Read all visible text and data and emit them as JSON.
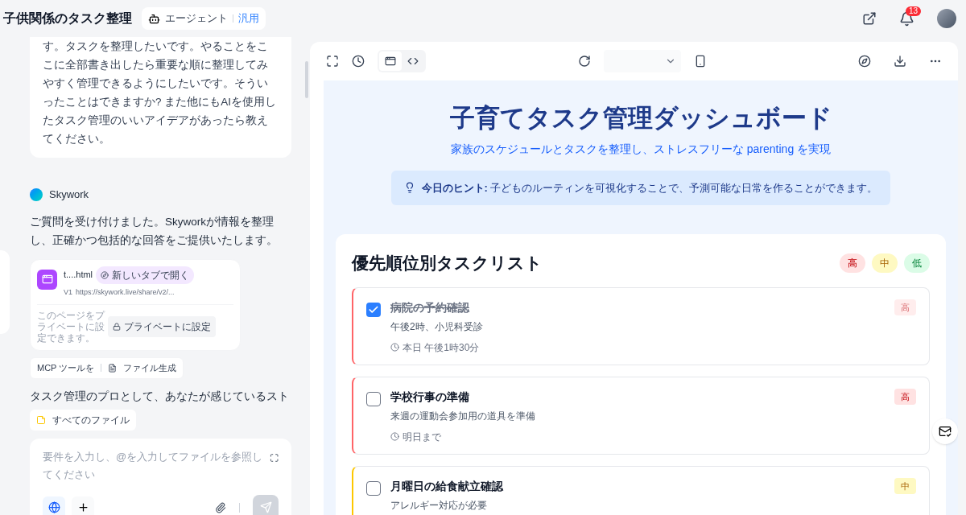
{
  "header": {
    "title": "子供関係のタスク整理",
    "mode": "エージェント",
    "mode_type": "汎用",
    "notification_count": "13"
  },
  "chat": {
    "user_message": "す。タスクを整理したいです。やることをここに全部書き出したら重要な順に整理してみやすく管理できるようにしたいです。そういったことはできますか? また他にもAIを使用したタスク管理のいいアイデアがあったら教えてください。",
    "assistant_name": "Skywork",
    "assistant_message": "ご質問を受け付けました。Skyworkが情報を整理し、正確かつ包括的な回答をご提供いたします。",
    "file_card": {
      "name": "t....html",
      "open_button": "新しいタブで開く",
      "version": "V1",
      "url": "https://skywork.live/share/v2/...",
      "privacy_note": "このページをプライベートに設定できます。",
      "private_button": "プライベートに設定"
    },
    "tools": [
      "MCP ツールを",
      "ファイル生成"
    ],
    "streaming_text": "タスク管理のプロとして、あなたが感じているスト",
    "all_files": "すべてのファイル",
    "input": {
      "placeholder": "要件を入力し、@を入力してファイルを参照してください",
      "web_search_on": true
    }
  },
  "preview": {
    "view_tabs": [
      {
        "kind": "preview",
        "selected": true
      },
      {
        "kind": "code",
        "selected": false
      }
    ],
    "page": {
      "title": "子育てタスク管理ダッシュボード",
      "subtitle": "家族のスケジュールとタスクを整理し、ストレスフリーな parenting を実現",
      "hint": "**今日のヒント:** 子どものルーティンを可視化することで、予測可能な日常を作ることができます。",
      "list_title": "優先順位別タスクリスト",
      "legend": [
        {
          "label": "高",
          "kind": "high"
        },
        {
          "label": "中",
          "kind": "medium"
        },
        {
          "label": "低",
          "kind": "low"
        }
      ],
      "tasks": [
        {
          "title": "病院の予約確認",
          "detail": "午後2時、小児科受診",
          "due": "本日 午後1時30分",
          "priority": "高",
          "kind": "high",
          "checked": true
        },
        {
          "title": "学校行事の準備",
          "detail": "来週の運動会参加用の道具を準備",
          "due": "明日まで",
          "priority": "高",
          "kind": "high",
          "checked": false
        },
        {
          "title": "月曜日の給食献立確認",
          "detail": "アレルギー対応が必要",
          "priority": "中",
          "kind": "medium",
          "checked": false
        }
      ]
    }
  }
}
